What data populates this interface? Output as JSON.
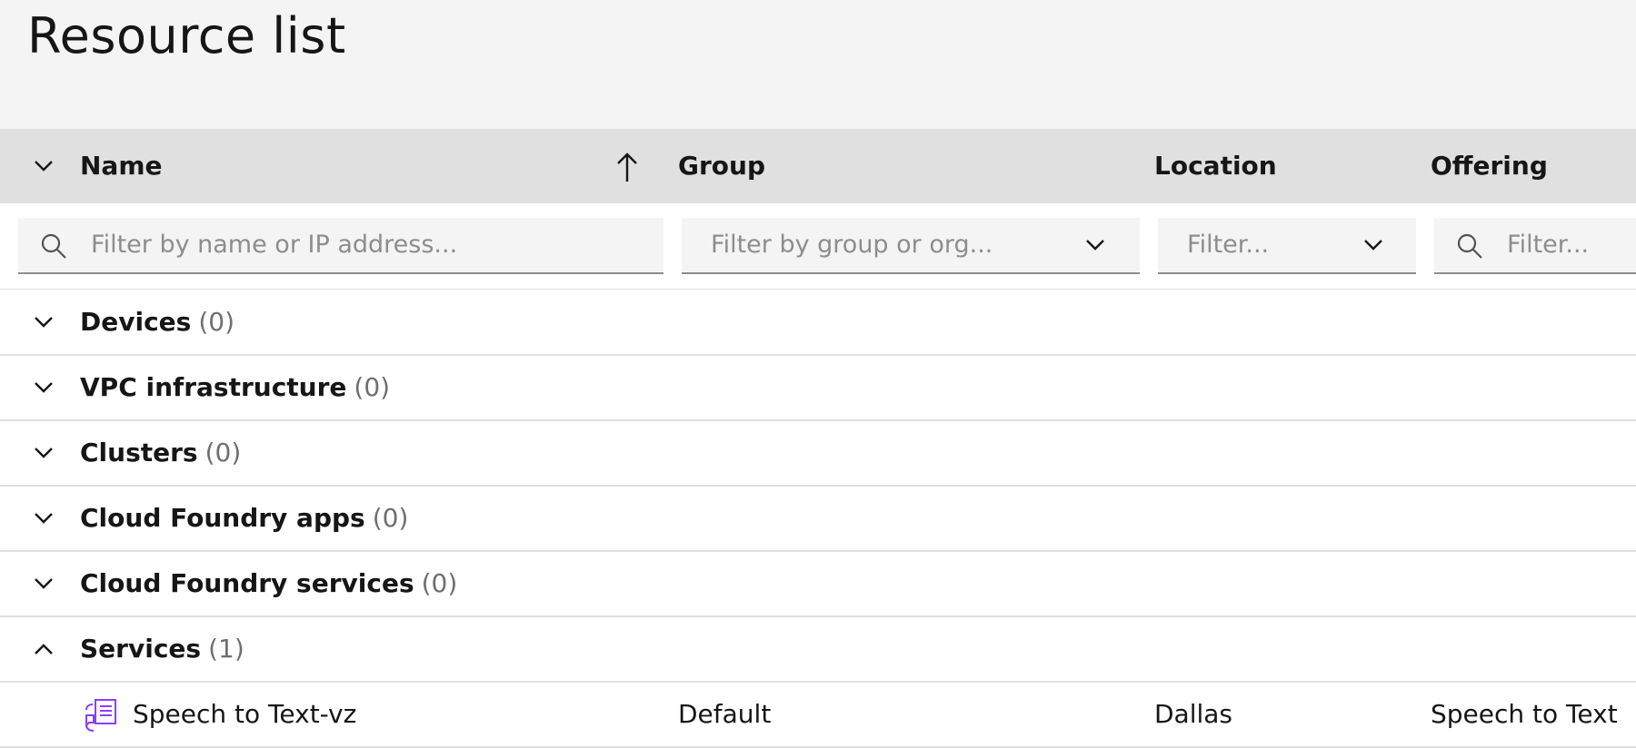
{
  "page": {
    "title": "Resource list"
  },
  "table": {
    "columns": [
      {
        "label": "Name",
        "sort": "ascending"
      },
      {
        "label": "Group"
      },
      {
        "label": "Location"
      },
      {
        "label": "Offering"
      }
    ],
    "filters": {
      "name_placeholder": "Filter by name or IP address...",
      "group_placeholder": "Filter by group or org...",
      "location_placeholder": "Filter...",
      "offering_placeholder": "Filter..."
    },
    "groups": [
      {
        "label": "Devices",
        "count": "(0)",
        "expanded": false
      },
      {
        "label": "VPC infrastructure",
        "count": "(0)",
        "expanded": false
      },
      {
        "label": "Clusters",
        "count": "(0)",
        "expanded": false
      },
      {
        "label": "Cloud Foundry apps",
        "count": "(0)",
        "expanded": false
      },
      {
        "label": "Cloud Foundry services",
        "count": "(0)",
        "expanded": false
      },
      {
        "label": "Services",
        "count": "(1)",
        "expanded": true
      }
    ],
    "rows": [
      {
        "name": "Speech to Text-vz",
        "group": "Default",
        "location": "Dallas",
        "offering": "Speech to Text",
        "icon": "speech-to-text-icon"
      }
    ]
  },
  "colors": {
    "title_bg": "#f4f4f4",
    "header_bg": "#e0e0e0",
    "field_bg": "#f4f4f4",
    "text_primary": "#161616",
    "text_placeholder": "#8d8d8d",
    "text_secondary": "#6f6f6f",
    "divider": "#e0e0e0",
    "icon_accent": "#8a3ffc"
  }
}
